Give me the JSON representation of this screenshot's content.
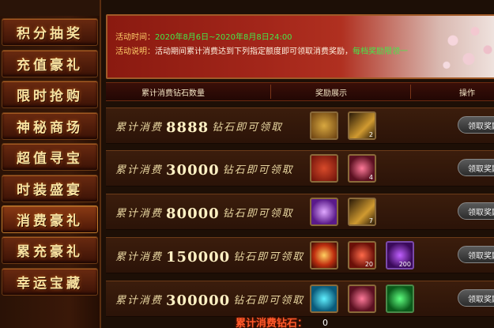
{
  "page_title": "活动时间",
  "sidebar": {
    "items": [
      {
        "label": "积分抽奖"
      },
      {
        "label": "充值豪礼"
      },
      {
        "label": "限时抢购"
      },
      {
        "label": "神秘商场"
      },
      {
        "label": "超值寻宝"
      },
      {
        "label": "时装盛宴"
      },
      {
        "label": "消费豪礼",
        "active": true
      },
      {
        "label": "累充豪礼"
      },
      {
        "label": "幸运宝藏"
      }
    ]
  },
  "info": {
    "time_label": "活动时间：",
    "time_value": "2020年8月6日~2020年8月8日24:00",
    "desc_label": "活动说明：",
    "desc_value": "活动期间累计消费达到下列指定额度即可领取消费奖励，",
    "desc_highlight": "每档奖励限领一"
  },
  "table": {
    "col_amount": "累计消费钻石数量",
    "col_reward": "奖励展示",
    "col_action": "操作",
    "rows": [
      {
        "prefix": "累计消费",
        "amount": "8888",
        "suffix": "钻石即可领取",
        "button": "领取奖励",
        "items": [
          {
            "icon": "gold-chest-icon",
            "count": ""
          },
          {
            "icon": "golden-scroll-icon",
            "count": "2"
          }
        ]
      },
      {
        "prefix": "累计消费",
        "amount": "30000",
        "suffix": "钻石即可领取",
        "button": "领取奖励",
        "items": [
          {
            "icon": "red-chest-icon",
            "count": ""
          },
          {
            "icon": "pink-crystal-icon",
            "count": "4"
          }
        ]
      },
      {
        "prefix": "累计消费",
        "amount": "80000",
        "suffix": "钻石即可领取",
        "button": "领取奖励",
        "items": [
          {
            "icon": "purple-orb-icon",
            "count": ""
          },
          {
            "icon": "golden-scroll-icon",
            "count": "7"
          }
        ]
      },
      {
        "prefix": "累计消费",
        "amount": "150000",
        "suffix": "钻石即可领取",
        "button": "领取奖励",
        "items": [
          {
            "icon": "fire-orb-icon",
            "count": ""
          },
          {
            "icon": "red-gem-icon",
            "count": "20"
          },
          {
            "icon": "purple-gem-icon",
            "count": "200"
          }
        ]
      },
      {
        "prefix": "累计消费",
        "amount": "300000",
        "suffix": "钻石即可领取",
        "button": "领取奖励",
        "items": [
          {
            "icon": "cyan-gem-icon",
            "count": ""
          },
          {
            "icon": "pink-crystal-icon",
            "count": ""
          },
          {
            "icon": "green-gem-icon",
            "count": ""
          }
        ]
      }
    ]
  },
  "footer": {
    "label": "累计消费钻石：",
    "value": "0"
  },
  "colors": {
    "accent_gold": "#f8e2a0",
    "accent_red": "#a3261a",
    "highlight_green": "#45e84a"
  }
}
